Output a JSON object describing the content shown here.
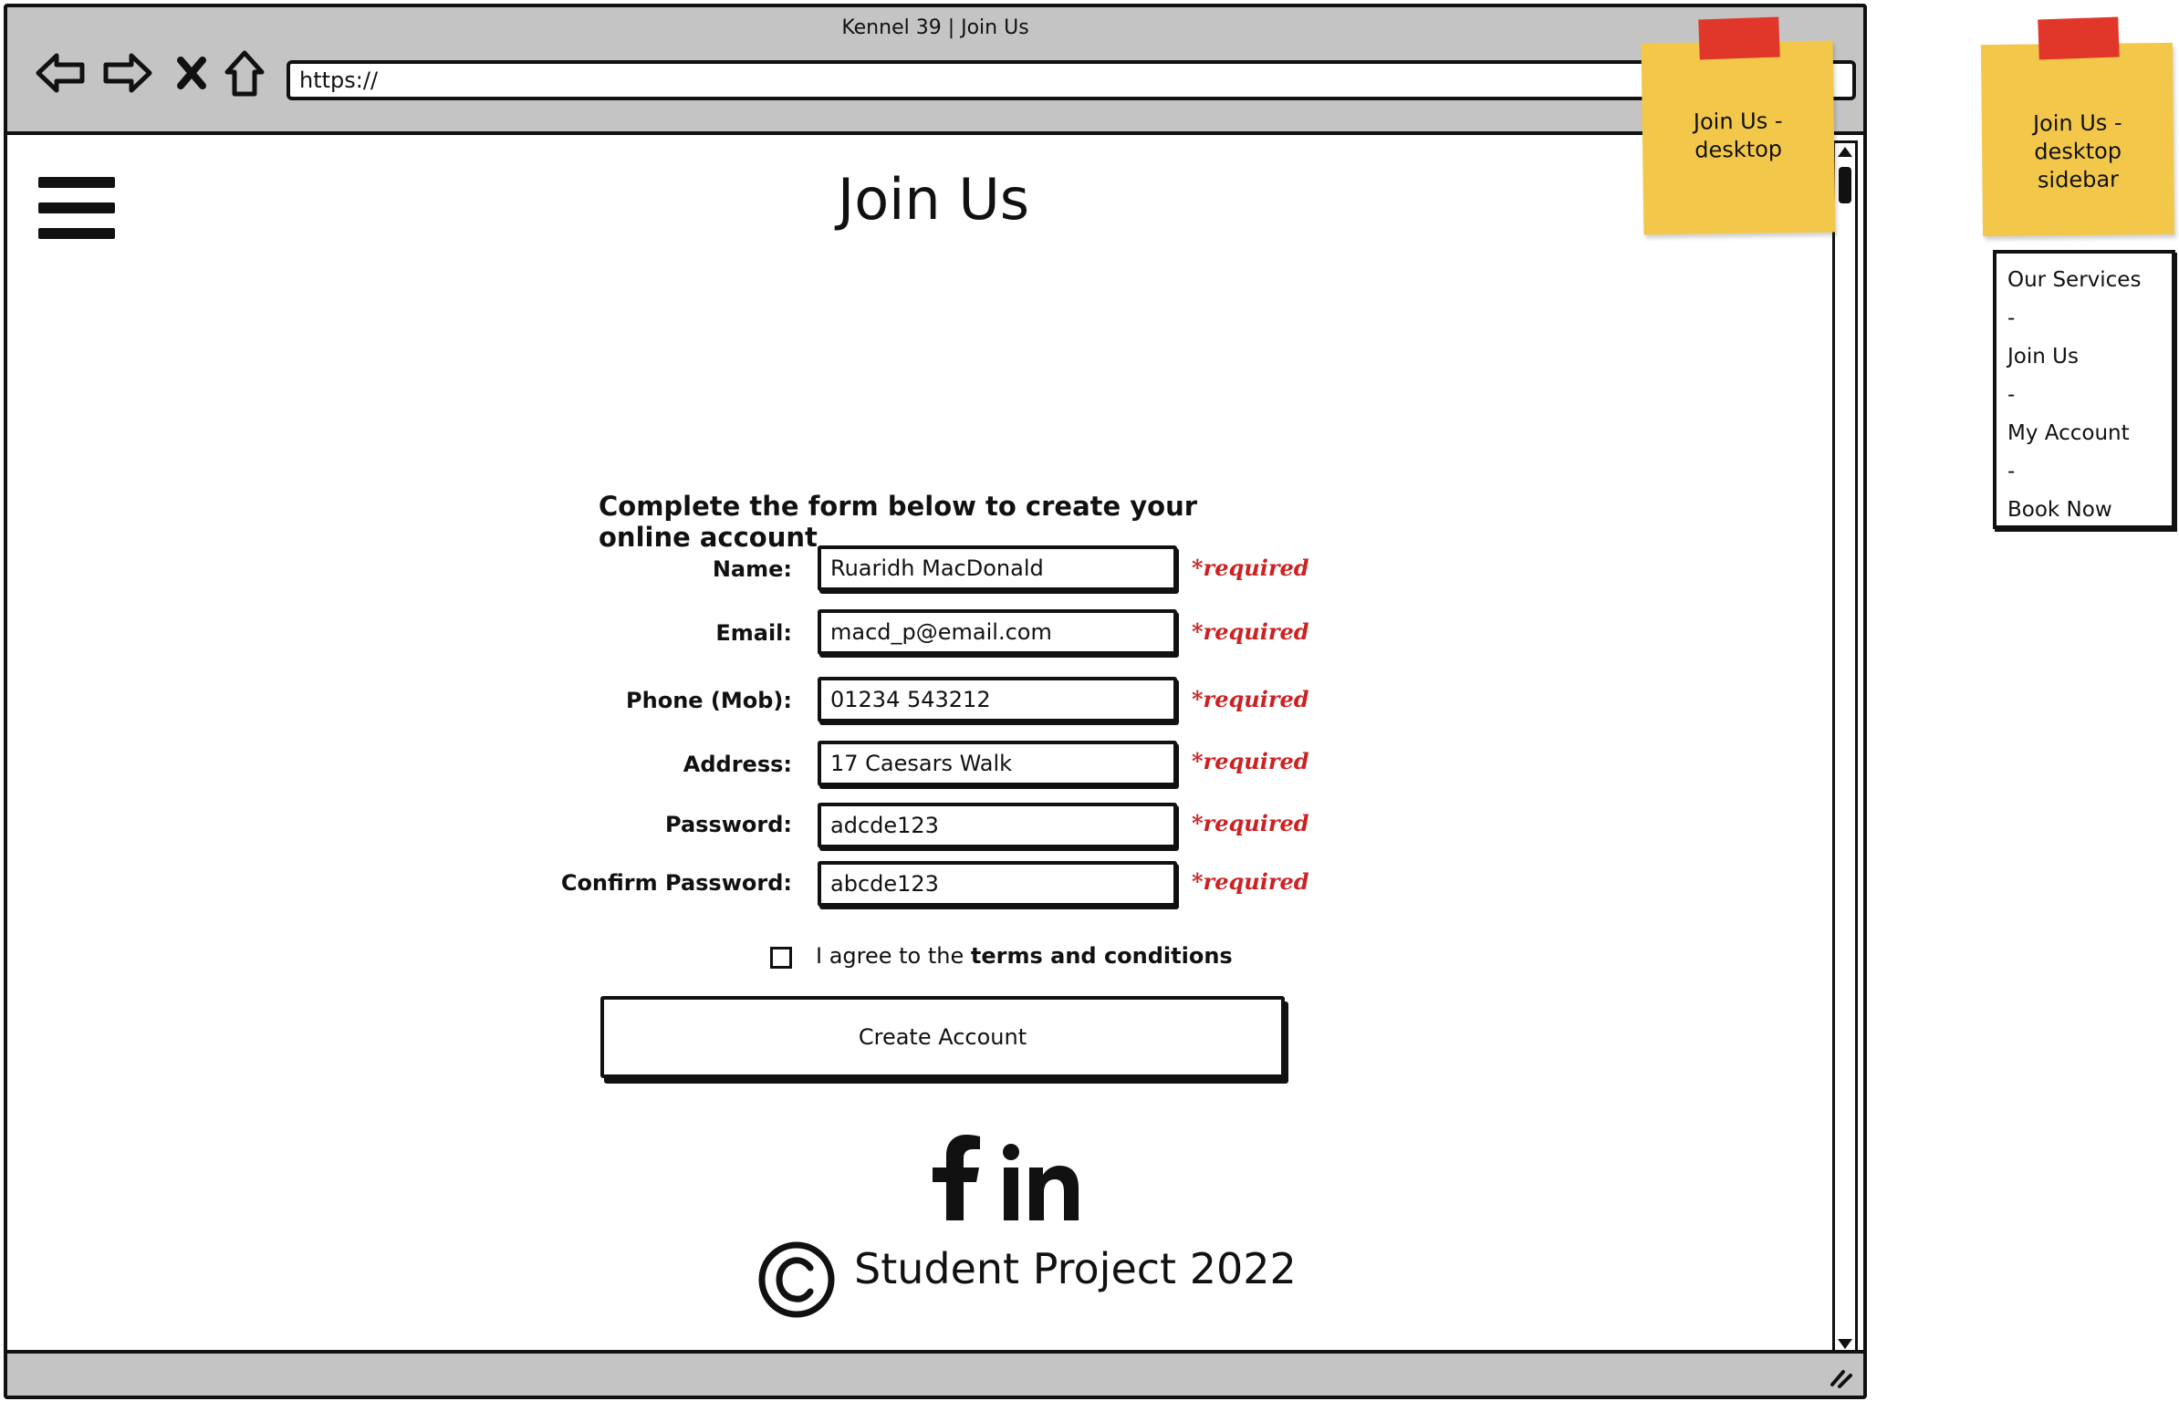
{
  "window": {
    "title": "Kennel 39 | Join Us",
    "url": "https://"
  },
  "page": {
    "title": "Join Us",
    "form_heading": "Complete the form below to create your online account",
    "fields": [
      {
        "label": "Name:",
        "value": "Ruaridh MacDonald",
        "note": "*required"
      },
      {
        "label": "Email:",
        "value": "macd_p@email.com",
        "note": "*required"
      },
      {
        "label": "Phone (Mob):",
        "value": "01234 543212",
        "note": "*required"
      },
      {
        "label": "Address:",
        "value": "17 Caesars Walk",
        "note": "*required"
      },
      {
        "label": "Password:",
        "value": "adcde123",
        "note": "*required"
      },
      {
        "label": "Confirm Password:",
        "value": "abcde123",
        "note": "*required"
      }
    ],
    "terms": {
      "prefix": "I agree to the ",
      "link": "terms and conditions",
      "checked": false
    },
    "submit_label": "Create Account",
    "social_icons": [
      "facebook-icon",
      "linkedin-icon"
    ],
    "footer_text": "Student Project 2022"
  },
  "notes": {
    "desktop": "Join Us -\ndesktop",
    "sidebar": "Join Us -\ndesktop\nsidebar"
  },
  "sidebar": {
    "items": [
      "Our Services",
      "-",
      "Join Us",
      "-",
      "My Account",
      "-",
      "Book Now"
    ]
  },
  "colors": {
    "chrome": "#c4c4c4",
    "required": "#cc2222",
    "sticky": "#f3c84a",
    "tape": "#e0372a"
  }
}
